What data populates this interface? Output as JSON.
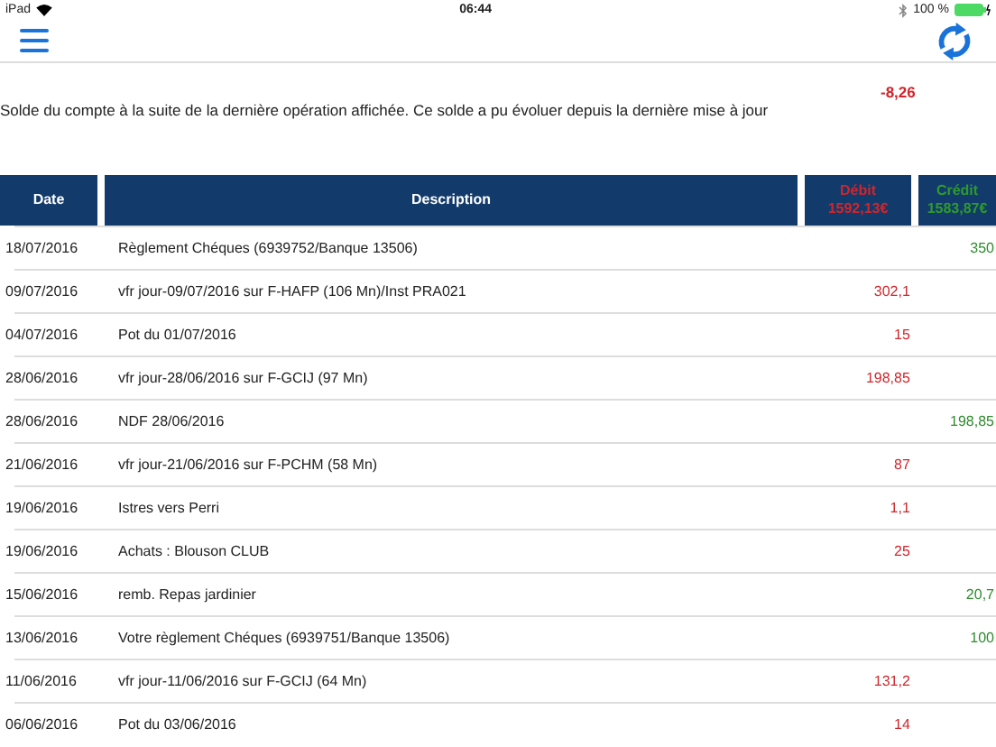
{
  "status_bar": {
    "device": "iPad",
    "time": "06:44",
    "battery": "100 %"
  },
  "balance": {
    "note": "Solde du compte à la suite de la dernière opération affichée. Ce solde a pu évoluer depuis la dernière mise à jour",
    "amount": "-8,26"
  },
  "table": {
    "columns": [
      {
        "label": "Date"
      },
      {
        "label": "Description"
      },
      {
        "label": "Débit",
        "total": "1592,13€"
      },
      {
        "label": "Crédit",
        "total": "1583,87€"
      }
    ],
    "rows": [
      {
        "date": "18/07/2016",
        "description": "Règlement Chéques (6939752/Banque 13506)",
        "credit": "350"
      },
      {
        "date": "09/07/2016",
        "description": "vfr jour-09/07/2016 sur F-HAFP (106 Mn)/Inst PRA021",
        "debit": "302,1"
      },
      {
        "date": "04/07/2016",
        "description": "Pot du 01/07/2016",
        "debit": "15"
      },
      {
        "date": "28/06/2016",
        "description": "vfr jour-28/06/2016 sur F-GCIJ (97 Mn)",
        "debit": "198,85"
      },
      {
        "date": "28/06/2016",
        "description": "NDF 28/06/2016",
        "credit": "198,85"
      },
      {
        "date": "21/06/2016",
        "description": "vfr jour-21/06/2016 sur F-PCHM (58 Mn)",
        "debit": "87"
      },
      {
        "date": "19/06/2016",
        "description": "Istres vers Perri",
        "debit": "1,1"
      },
      {
        "date": "19/06/2016",
        "description": "Achats : Blouson CLUB",
        "debit": "25"
      },
      {
        "date": "15/06/2016",
        "description": "remb. Repas jardinier",
        "credit": "20,7"
      },
      {
        "date": "13/06/2016",
        "description": "Votre règlement Chéques (6939751/Banque 13506)",
        "credit": "100"
      },
      {
        "date": "11/06/2016",
        "description": "vfr jour-11/06/2016 sur F-GCIJ (64 Mn)",
        "debit": "131,2"
      },
      {
        "date": "06/06/2016",
        "description": "Pot du 03/06/2016",
        "debit": "14"
      }
    ]
  }
}
